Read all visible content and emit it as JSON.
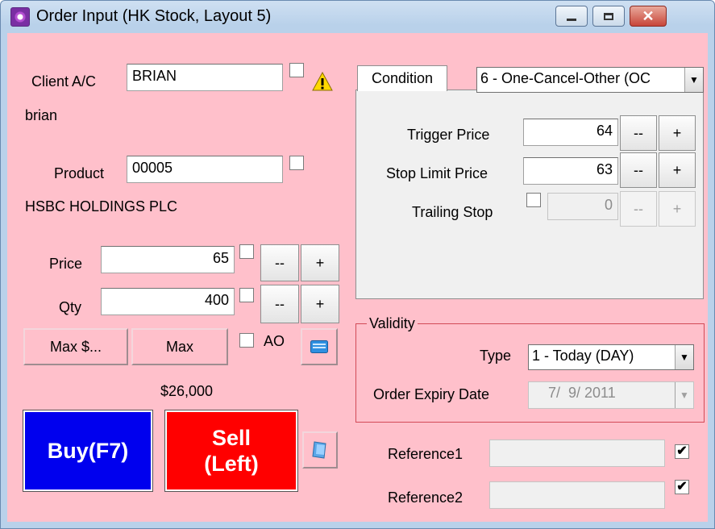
{
  "window": {
    "title": "Order Input (HK Stock, Layout 5)",
    "buttons": {
      "minimize": "▁",
      "maximize": "▢",
      "close": "✕"
    }
  },
  "client": {
    "label": "Client A/C",
    "value": "BRIAN",
    "name": "brian",
    "warning_icon": "warning-triangle-icon"
  },
  "product": {
    "label": "Product",
    "value": "00005",
    "name": "HSBC HOLDINGS PLC"
  },
  "price": {
    "label": "Price",
    "value": "65",
    "dec": "--",
    "inc": "+"
  },
  "qty": {
    "label": "Qty",
    "value": "400",
    "dec": "--",
    "inc": "+"
  },
  "max_amount_button": "Max $...",
  "max_button": "Max",
  "ao_label": "AO",
  "amount": "$26,000",
  "buy_button": "Buy(F7)",
  "sell_button_line1": "Sell",
  "sell_button_line2": "(Left)",
  "condition": {
    "tab": "Condition",
    "type_selected": "6 - One-Cancel-Other (OC",
    "trigger_label": "Trigger Price",
    "trigger_value": "64",
    "stop_limit_label": "Stop Limit Price",
    "stop_limit_value": "63",
    "trailing_label": "Trailing Stop",
    "trailing_value": "0",
    "dec": "--",
    "inc": "+"
  },
  "validity": {
    "legend": "Validity",
    "type_label": "Type",
    "type_selected": "1 - Today (DAY)",
    "expiry_label": "Order Expiry Date",
    "expiry_value": "7/  9/ 2011"
  },
  "reference1": {
    "label": "Reference1",
    "value": "",
    "checked": "✔"
  },
  "reference2": {
    "label": "Reference2",
    "value": "",
    "checked": "✔"
  },
  "colors": {
    "panel_bg": "#ffc0cb",
    "buy": "#0000ee",
    "sell": "#ff0000",
    "validity_border": "#d24a57"
  }
}
